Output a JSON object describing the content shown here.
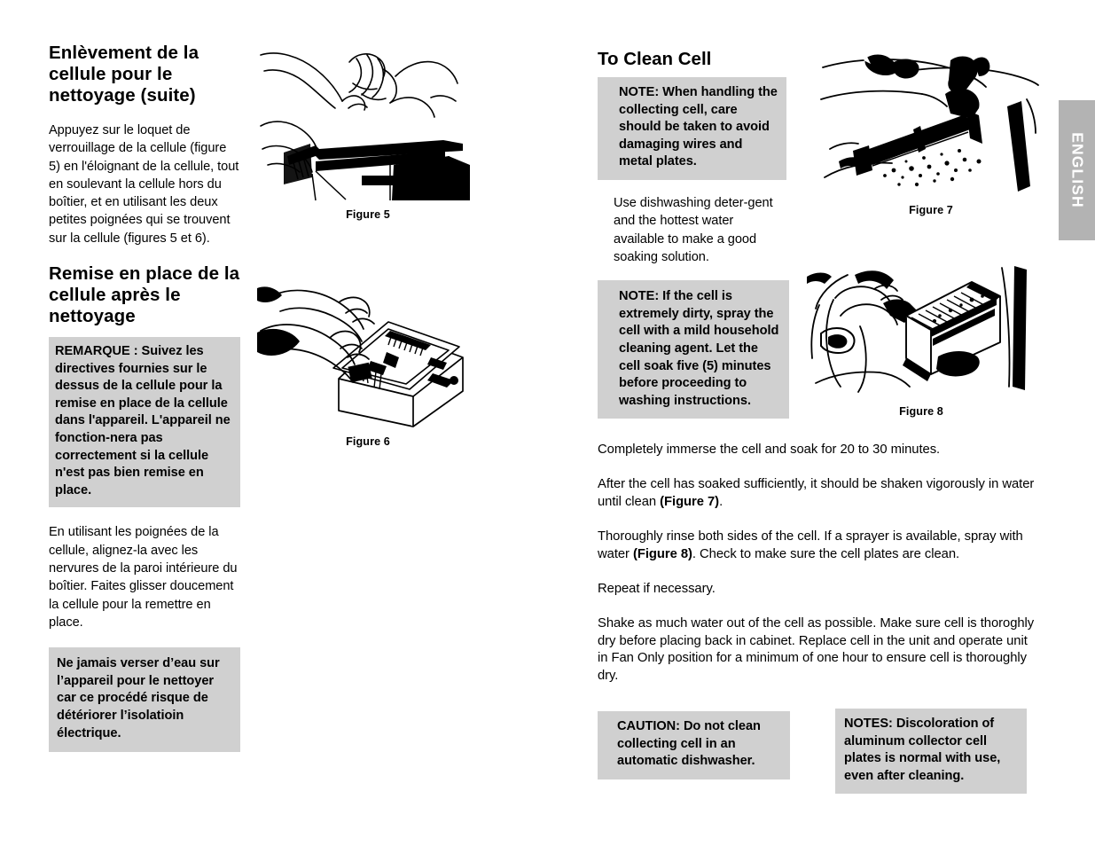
{
  "page": {
    "side_tab_label": "ENGLISH",
    "box_grey": "#d0d0d0",
    "tab_grey": "#b3b3b3"
  },
  "left_column": {
    "heading": "Enlèvement de la cellule pour le nettoyage (suite)",
    "paragraph_1": "Appuyez sur le loquet de verrouillage de la cellule (figure 5) en l'éloignant de la cellule, tout en soulevant la cellule hors du boîtier, et en utilisant les deux petites poignées qui se trouvent sur la cellule (figures 5 et 6).",
    "heading_2": "Remise en place de la cellule après le nettoyage",
    "note_remarque": "REMARQUE : Suivez les directives fournies sur le dessus de la cellule pour la remise en place de la cellule dans l'appareil. L'appareil ne fonction-nera pas correctement si la cellule n'est pas bien remise en place.",
    "paragraph_2": "En utilisant les poignées de la cellule, alignez-la avec les nervures de la paroi intérieure du boîtier. Faites glisser doucement la cellule pour la remettre en place.",
    "note_warning": "Ne jamais verser d’eau sur l’appareil pour le nettoyer car ce procédé risque de détériorer l’isolatioin électrique."
  },
  "right_column": {
    "heading": "To Clean Cell",
    "note_1": "NOTE: When handling the collecting cell, care should be taken to avoid damaging wires and metal plates.",
    "paragraph_1": "Use dishwashing deter-gent and the hottest water available to make a good soaking solution.",
    "note_2": "NOTE: If the cell is extremely dirty, spray the cell with a mild household cleaning agent. Let the cell soak five (5) minutes before proceeding to washing instructions.",
    "paragraph_2": "Completely immerse the cell and soak for 20 to 30 minutes.",
    "paragraph_3_a": "After the cell has soaked sufficiently, it should be shaken vigorously in water until clean ",
    "paragraph_3_bold": "(Figure 7)",
    "paragraph_3_b": ".",
    "paragraph_4_a": "Thoroughly rinse both sides of the cell. If a sprayer is available, spray with water ",
    "paragraph_4_bold": "(Figure 8)",
    "paragraph_4_b": ". Check to make sure the cell plates are clean.",
    "paragraph_5": "Repeat if necessary.",
    "paragraph_6": "Shake as much water out of the cell as possible. Make sure cell is thoroghly dry before placing back in cabinet. Replace cell in the unit and operate unit in Fan Only position for a minimum of one hour to ensure cell is thoroughly dry.",
    "caution_box": "CAUTION: Do not clean collecting cell in an automatic dishwasher.",
    "notes_box": "NOTES: Discoloration of aluminum collector cell plates is normal with use, even after cleaning."
  },
  "figures": {
    "fig5_caption": "Figure 5",
    "fig6_caption": "Figure 6",
    "fig7_caption": "Figure 7",
    "fig8_caption": "Figure 8"
  }
}
